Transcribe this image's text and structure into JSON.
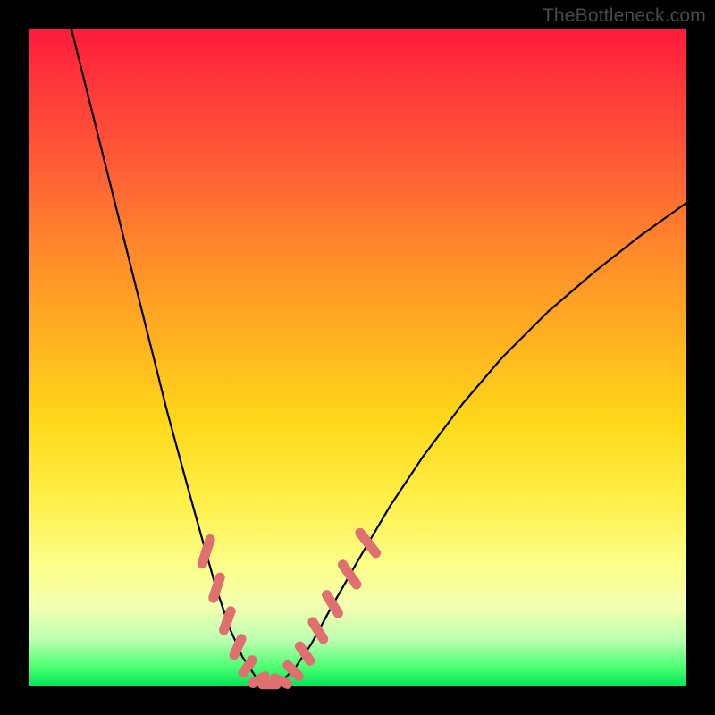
{
  "watermark": "TheBottleneck.com",
  "colors": {
    "background": "#000000",
    "curve_stroke": "#000000",
    "marker_fill": "#e0706f",
    "gradient_stops": [
      "#ff1a3c",
      "#ff3a3a",
      "#ff5a36",
      "#ff8a2a",
      "#ffb41f",
      "#ffd91a",
      "#fff04a",
      "#fcff8c",
      "#f2ffb0",
      "#baffb0",
      "#4dff72",
      "#00e657"
    ]
  },
  "chart_data": {
    "type": "line",
    "title": "",
    "xlabel": "",
    "ylabel": "",
    "xlim": [
      0,
      100
    ],
    "ylim": [
      0,
      100
    ],
    "curve_points": [
      {
        "x": 6.5,
        "y": 100
      },
      {
        "x": 9.0,
        "y": 90
      },
      {
        "x": 12.0,
        "y": 78
      },
      {
        "x": 15.0,
        "y": 66
      },
      {
        "x": 18.0,
        "y": 54
      },
      {
        "x": 21.0,
        "y": 42
      },
      {
        "x": 24.0,
        "y": 31
      },
      {
        "x": 26.5,
        "y": 22
      },
      {
        "x": 28.5,
        "y": 15
      },
      {
        "x": 30.5,
        "y": 9
      },
      {
        "x": 32.5,
        "y": 4.5
      },
      {
        "x": 34.5,
        "y": 1.5
      },
      {
        "x": 36.5,
        "y": 0.3
      },
      {
        "x": 38.5,
        "y": 0.8
      },
      {
        "x": 40.5,
        "y": 2.8
      },
      {
        "x": 43.0,
        "y": 6.5
      },
      {
        "x": 46.0,
        "y": 12
      },
      {
        "x": 50.0,
        "y": 19
      },
      {
        "x": 55.0,
        "y": 27.5
      },
      {
        "x": 60.0,
        "y": 35
      },
      {
        "x": 66.0,
        "y": 43
      },
      {
        "x": 72.0,
        "y": 50
      },
      {
        "x": 79.0,
        "y": 57
      },
      {
        "x": 86.0,
        "y": 63
      },
      {
        "x": 93.0,
        "y": 68.5
      },
      {
        "x": 100.0,
        "y": 73.5
      }
    ],
    "markers": [
      {
        "x": 27.0,
        "y": 20.5,
        "len": 4.5,
        "angle": 72
      },
      {
        "x": 28.6,
        "y": 15.0,
        "len": 4.0,
        "angle": 72
      },
      {
        "x": 30.2,
        "y": 10.0,
        "len": 3.8,
        "angle": 70
      },
      {
        "x": 31.8,
        "y": 6.0,
        "len": 3.5,
        "angle": 66
      },
      {
        "x": 33.3,
        "y": 3.0,
        "len": 3.2,
        "angle": 55
      },
      {
        "x": 35.0,
        "y": 1.0,
        "len": 3.0,
        "angle": 30
      },
      {
        "x": 36.6,
        "y": 0.3,
        "len": 3.0,
        "angle": 0
      },
      {
        "x": 38.4,
        "y": 0.8,
        "len": 3.0,
        "angle": -25
      },
      {
        "x": 40.2,
        "y": 2.4,
        "len": 3.2,
        "angle": -45
      },
      {
        "x": 42.0,
        "y": 5.0,
        "len": 3.5,
        "angle": -55
      },
      {
        "x": 44.0,
        "y": 8.5,
        "len": 3.8,
        "angle": -58
      },
      {
        "x": 46.2,
        "y": 12.5,
        "len": 4.0,
        "angle": -58
      },
      {
        "x": 48.8,
        "y": 17.0,
        "len": 4.3,
        "angle": -55
      },
      {
        "x": 51.6,
        "y": 21.8,
        "len": 4.5,
        "angle": -52
      }
    ]
  }
}
